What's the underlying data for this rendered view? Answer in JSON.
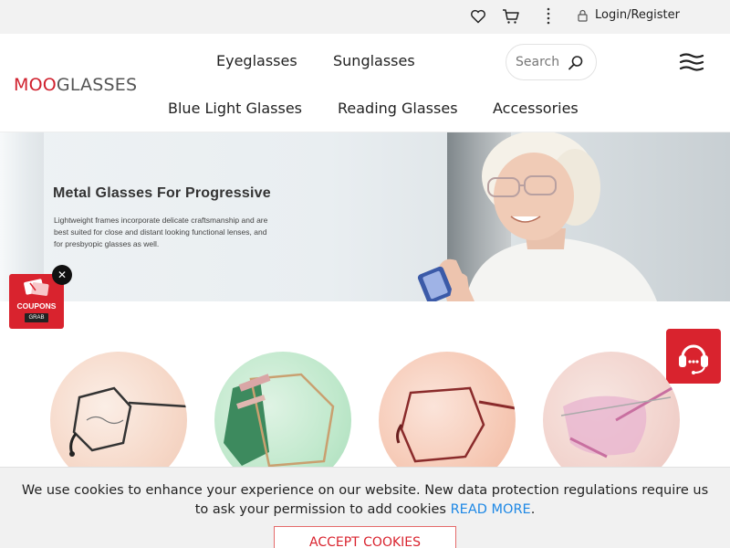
{
  "topbar": {
    "login_label": "Login/Register"
  },
  "logo": {
    "part1": "MOO",
    "part2": "GLASSES"
  },
  "nav": {
    "items": [
      {
        "label": "Eyeglasses"
      },
      {
        "label": "Sunglasses"
      },
      {
        "label": "Blue Light Glasses"
      },
      {
        "label": "Reading Glasses"
      },
      {
        "label": "Accessories"
      }
    ]
  },
  "search": {
    "placeholder": "Search"
  },
  "hero": {
    "title": "Metal Glasses For Progressive",
    "description_lines": [
      "Lightweight frames incorporate delicate craftsmanship and are",
      "best suited for close and distant looking functional lenses, and",
      "for presbyopic glasses as well."
    ]
  },
  "coupon": {
    "label": "COUPONS",
    "grab": "GRAB"
  },
  "cookie": {
    "text_before": "We use cookies to enhance your experience on our website. New data protection regulations require us to ask your permission to add cookies ",
    "link": "READ MORE",
    "text_after": ".",
    "accept_label": "ACCEPT COOKIES"
  },
  "colors": {
    "brand": "#d9232e",
    "link": "#1e88e5"
  },
  "icons": [
    "heart-icon",
    "cart-icon",
    "more-vertical-icon",
    "lock-icon",
    "search-icon",
    "hamburger-menu-icon",
    "close-icon",
    "headset-icon",
    "coupon-icon"
  ]
}
